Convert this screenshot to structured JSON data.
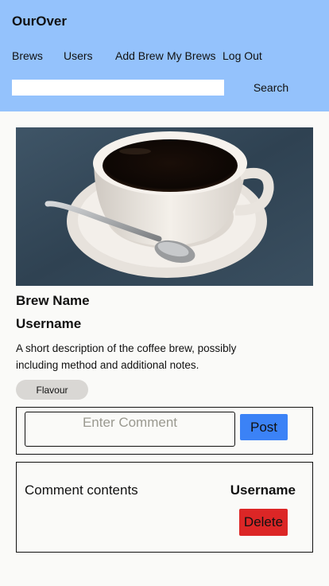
{
  "header": {
    "app_title": "OurOver",
    "nav": [
      "Brews",
      "Users",
      "Add Brew",
      "My Brews",
      "Log Out"
    ],
    "search_value": "",
    "search_button": "Search"
  },
  "brew": {
    "image_icon": "coffee-cup-photo",
    "name": "Brew Name",
    "username": "Username",
    "description": "A short description of the coffee brew, possibly including method and additional notes.",
    "flavour": "Flavour"
  },
  "comment_form": {
    "placeholder": "Enter Comment",
    "post_label": "Post"
  },
  "comments": [
    {
      "text": "Comment contents",
      "username": "Username",
      "delete_label": "Delete"
    }
  ],
  "colors": {
    "header_bg": "#94c2fc",
    "post_button": "#3b82f6",
    "delete_button": "#dc2626",
    "flavour_tag": "#d9d7d4"
  }
}
